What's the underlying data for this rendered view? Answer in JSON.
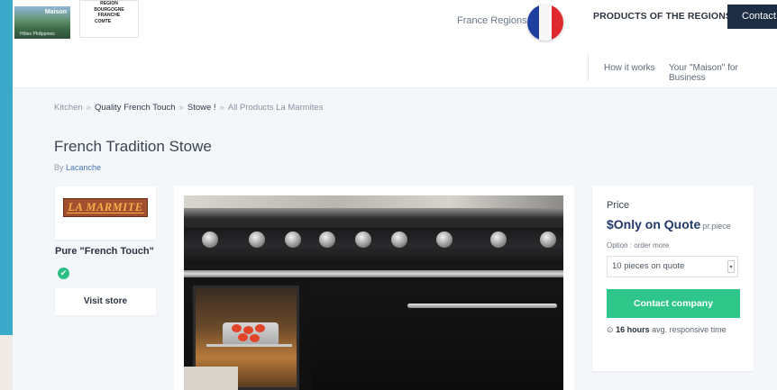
{
  "header": {
    "logo_photo_title": "Maison",
    "logo_photo_subtitle": "Hôtes Philippines",
    "region_logo_lines": [
      "REGION",
      "BOURGOGNE",
      "FRANCHE",
      "COMTE"
    ],
    "regions_label": "France Regions",
    "products_button": "PRODUCTS OF THE REGIONS",
    "contact_button": "Contact",
    "nav": {
      "how_it_works": "How it works",
      "maison_business": "Your \"Maison\" for Business"
    }
  },
  "breadcrumb": {
    "items": [
      "Kitchen",
      "Quality French Touch",
      "Stowe !",
      "All Products La Marmites"
    ],
    "separator": "»"
  },
  "product": {
    "title": "French Tradition Stowe",
    "by_prefix": "By",
    "brand": "Lacanche"
  },
  "seller": {
    "logo_text": "LA MARMITE",
    "name": "Pure \"French Touch\"",
    "verified_glyph": "✔",
    "visit_store": "Visit store"
  },
  "pricing": {
    "price_label": "Price",
    "price_value": "$Only on Quote",
    "price_unit": "pr.piece",
    "option_label": "Option : order more",
    "option_selected": "10 pieces on quote",
    "contact_company": "Contact company",
    "response_icon": "clock-icon",
    "response_time": "16 hours",
    "response_suffix": "avg. responsive time"
  },
  "colors": {
    "accent_green": "#2ec689",
    "navy": "#1d2d44",
    "price_blue": "#223a6a",
    "frame_teal": "#3ba9c9"
  }
}
